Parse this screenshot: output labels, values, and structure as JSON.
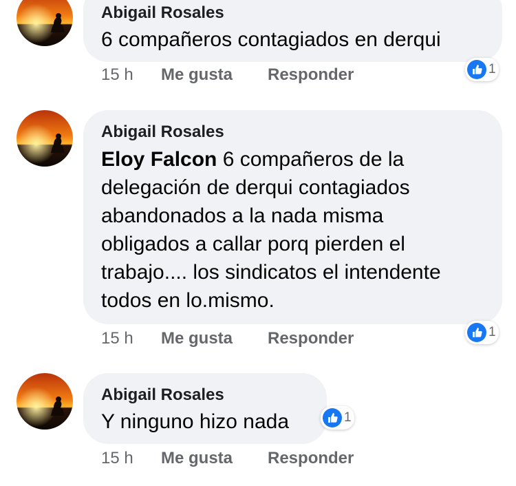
{
  "comments": [
    {
      "author": "Abigail Rosales",
      "mention": "",
      "text": "6 compañeros contagiados en derqui",
      "time": "15 h",
      "like_label": "Me gusta",
      "reply_label": "Responder",
      "reaction_count": "1"
    },
    {
      "author": "Abigail Rosales",
      "mention": "Eloy Falcon",
      "text_lines": [
        "6 compañeros de la",
        "delegación de derqui contagiados",
        "abandonados a la nada misma",
        "obligados a callar porq pierden el",
        "trabajo.... los sindicatos el intendente",
        "todos en lo.mismo."
      ],
      "time": "15 h",
      "like_label": "Me gusta",
      "reply_label": "Responder",
      "reaction_count": "1"
    },
    {
      "author": "Abigail Rosales",
      "mention": "",
      "text": "Y ninguno hizo nada",
      "time": "15 h",
      "like_label": "Me gusta",
      "reply_label": "Responder",
      "reaction_count": "1"
    }
  ],
  "colors": {
    "bubble": "#f0f2f5",
    "like_blue": "#1877f2",
    "meta_gray": "#65676b"
  },
  "icons": {
    "reaction": "thumbs-up-icon",
    "avatar": "sunset-silhouette-avatar"
  }
}
